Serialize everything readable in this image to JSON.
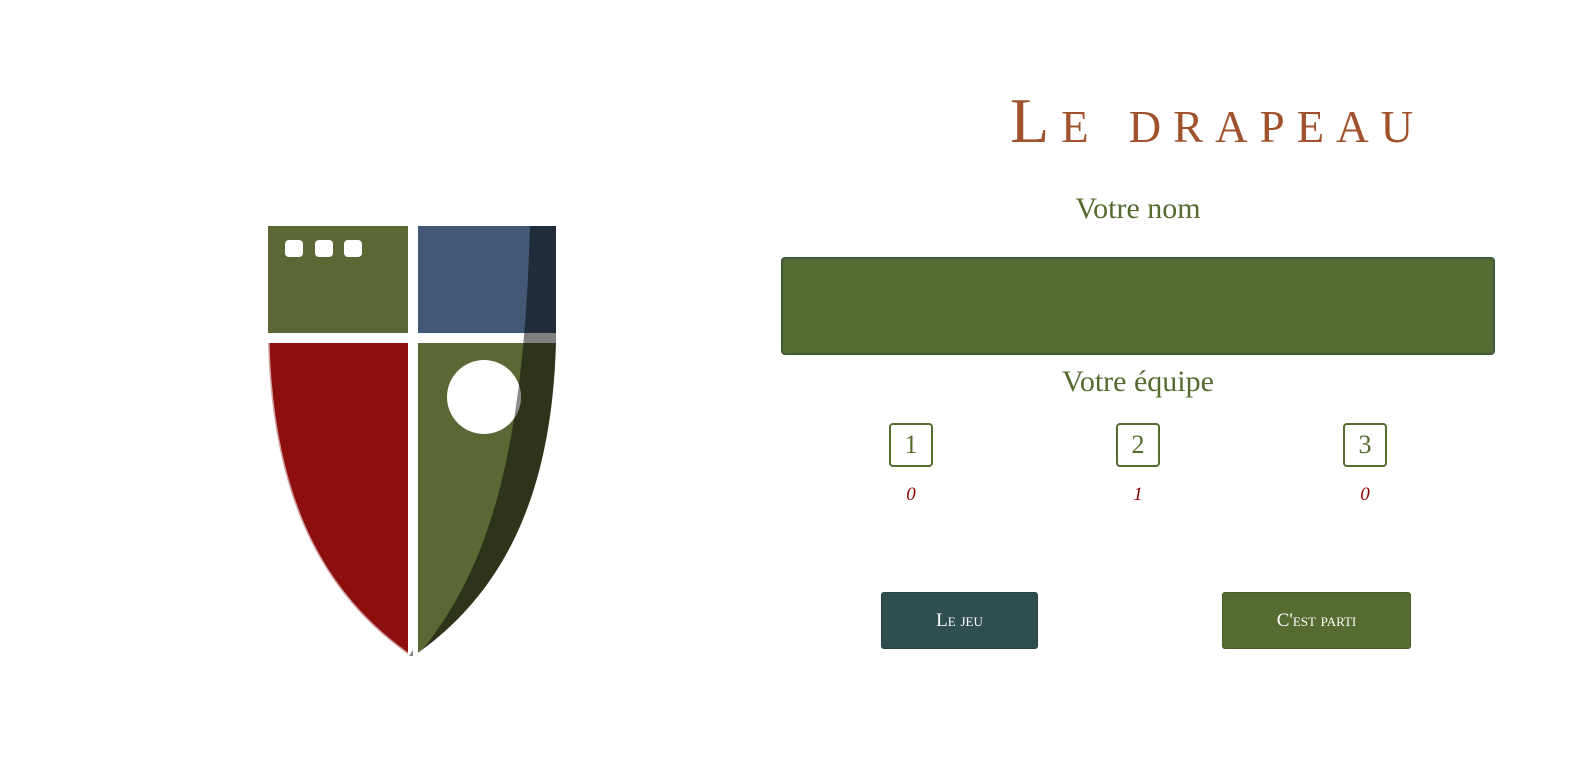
{
  "title": "Le drapeau",
  "form": {
    "name_label": "Votre nom",
    "name_value": "",
    "team_label": "Votre équipe"
  },
  "teams": [
    {
      "number": "1",
      "count": "0"
    },
    {
      "number": "2",
      "count": "1"
    },
    {
      "number": "3",
      "count": "0"
    }
  ],
  "buttons": {
    "rules_label": "Le jeu",
    "start_label": "C'est parti"
  },
  "colors": {
    "title": "#a0522d",
    "olive": "#556b2f",
    "dark_slate": "#2f4f4f",
    "crimson": "#8b0000",
    "shield_blue": "#445a78",
    "shield_red": "#8b0e0e"
  }
}
